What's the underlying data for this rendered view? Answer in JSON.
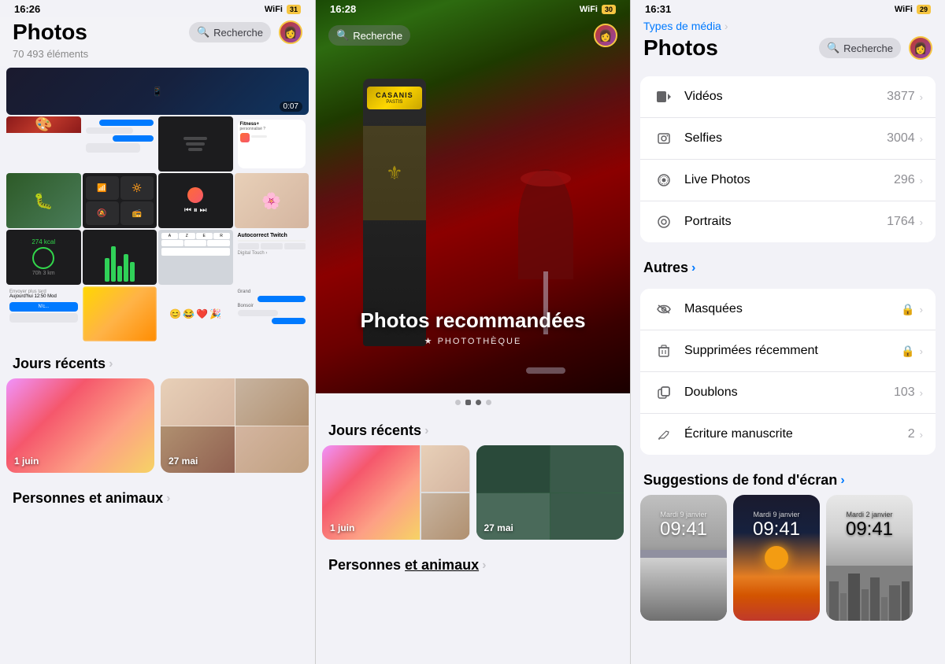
{
  "panel1": {
    "status": {
      "time": "16:26",
      "signal": "●●●",
      "wifi": "WiFi",
      "battery": "31"
    },
    "title": "Photos",
    "elementCount": "70 493 éléments",
    "searchPlaceholder": "Recherche",
    "sections": {
      "recentDays": "Jours récents",
      "recentDaysArrow": "›",
      "people": "Personnes et animaux",
      "peopleArrow": "›"
    },
    "days": [
      {
        "label": "1 juin"
      },
      {
        "label": "27 mai"
      }
    ]
  },
  "panel2": {
    "status": {
      "time": "16:28",
      "battery": "30"
    },
    "searchPlaceholder": "Recherche",
    "hero": {
      "casanis": "CASANIS",
      "title": "Photos recommandées",
      "subtitle": "★ PHOTOTHÈQUE"
    },
    "dots": [
      "",
      "",
      "active",
      ""
    ],
    "sections": {
      "recentDays": "Jours récents",
      "recentDaysArrow": "›",
      "people": "Personnes",
      "peopleUnderline": "et animaux",
      "peopleArrow": "›"
    },
    "days": [
      {
        "label": "1 juin"
      },
      {
        "label": "27 mai"
      }
    ]
  },
  "panel3": {
    "status": {
      "time": "16:31",
      "battery": "29"
    },
    "breadcrumb": "Types de média",
    "breadcrumbArrow": "›",
    "title": "Photos",
    "searchPlaceholder": "Recherche",
    "mediaTypes": [
      {
        "icon": "▶",
        "label": "Vidéos",
        "count": "3877",
        "hasArrow": true
      },
      {
        "icon": "🤳",
        "label": "Selfies",
        "count": "3004",
        "hasArrow": true
      },
      {
        "icon": "⊙",
        "label": "Live Photos",
        "count": "296",
        "hasArrow": true
      },
      {
        "icon": "◎",
        "label": "Portraits",
        "count": "1764",
        "hasArrow": true
      }
    ],
    "autres": {
      "title": "Autres",
      "arrow": "›",
      "items": [
        {
          "icon": "👁",
          "label": "Masquées",
          "lock": true
        },
        {
          "icon": "🗑",
          "label": "Supprimées récemment",
          "lock": true
        },
        {
          "icon": "⧉",
          "label": "Doublons",
          "count": "103"
        },
        {
          "icon": "✏",
          "label": "Écriture manuscrite",
          "count": "2"
        }
      ]
    },
    "suggestions": {
      "title": "Suggestions de fond d'écran",
      "arrow": "›"
    },
    "wallpapers": [
      {
        "type": "beach",
        "date": "Mardi 9 janvier",
        "time": "09:41"
      },
      {
        "type": "sunset",
        "date": "Mardi 9 janvier",
        "time": "09:41"
      },
      {
        "type": "city",
        "date": "Mardi 2 janvier",
        "time": "09:41"
      }
    ]
  }
}
